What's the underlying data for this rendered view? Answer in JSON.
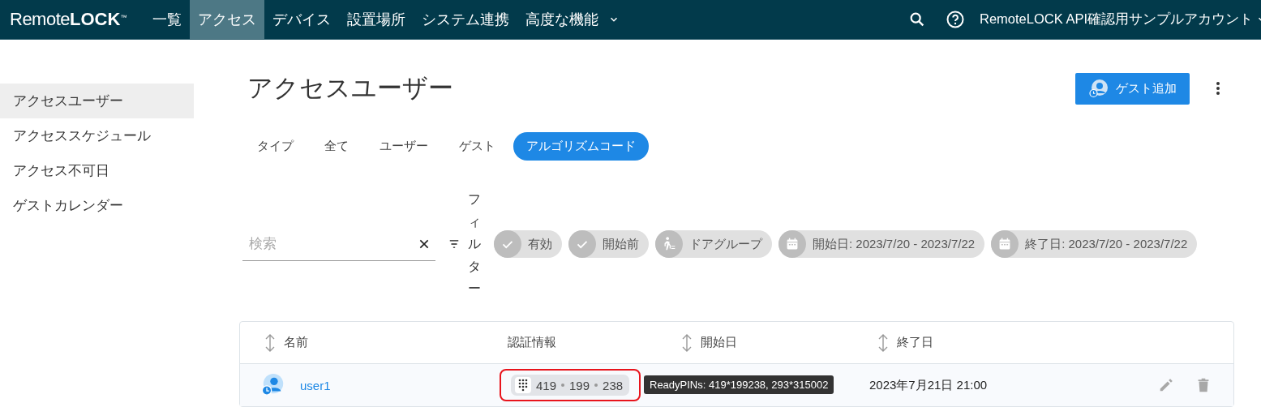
{
  "header": {
    "logo": {
      "text": "Remote",
      "accent": "LOCK",
      "mark": "™"
    },
    "nav": [
      {
        "label": "一覧",
        "selected": false
      },
      {
        "label": "アクセス",
        "selected": true
      },
      {
        "label": "デバイス",
        "selected": false
      },
      {
        "label": "設置場所",
        "selected": false
      },
      {
        "label": "システム連携",
        "selected": false
      },
      {
        "label": "高度な機能",
        "selected": false,
        "dropdown": true
      }
    ],
    "account": "RemoteLOCK API確認用サンプルアカウント"
  },
  "sidebar": {
    "items": [
      {
        "label": "アクセスユーザー",
        "selected": true
      },
      {
        "label": "アクセススケジュール",
        "selected": false
      },
      {
        "label": "アクセス不可日",
        "selected": false
      },
      {
        "label": "ゲストカレンダー",
        "selected": false
      }
    ]
  },
  "page": {
    "title": "アクセスユーザー",
    "add_button": "ゲスト追加"
  },
  "type_filter": {
    "label": "タイプ",
    "options": [
      {
        "label": "全て",
        "selected": false
      },
      {
        "label": "ユーザー",
        "selected": false
      },
      {
        "label": "ゲスト",
        "selected": false
      },
      {
        "label": "アルゴリズムコード",
        "selected": true
      }
    ]
  },
  "search": {
    "placeholder": "検索"
  },
  "filter_label": "フィルター",
  "chips": [
    {
      "kind": "check",
      "label": "有効"
    },
    {
      "kind": "check",
      "label": "開始前"
    },
    {
      "kind": "door",
      "label": "ドアグループ"
    },
    {
      "kind": "calendar",
      "label": "開始日: 2023/7/20 - 2023/7/22"
    },
    {
      "kind": "calendar",
      "label": "終了日: 2023/7/20 - 2023/7/22"
    }
  ],
  "table": {
    "columns": [
      {
        "label": "名前",
        "sortable": true
      },
      {
        "label": "認証情報",
        "sortable": false
      },
      {
        "label": "開始日",
        "sortable": true
      },
      {
        "label": "終了日",
        "sortable": true
      }
    ],
    "rows": [
      {
        "name": "user1",
        "pin": [
          "419",
          "199",
          "238"
        ],
        "highlighted": true,
        "tooltip": "ReadyPINs: 419*199238, 293*315002",
        "end": "2023年7月21日 21:00"
      }
    ]
  }
}
